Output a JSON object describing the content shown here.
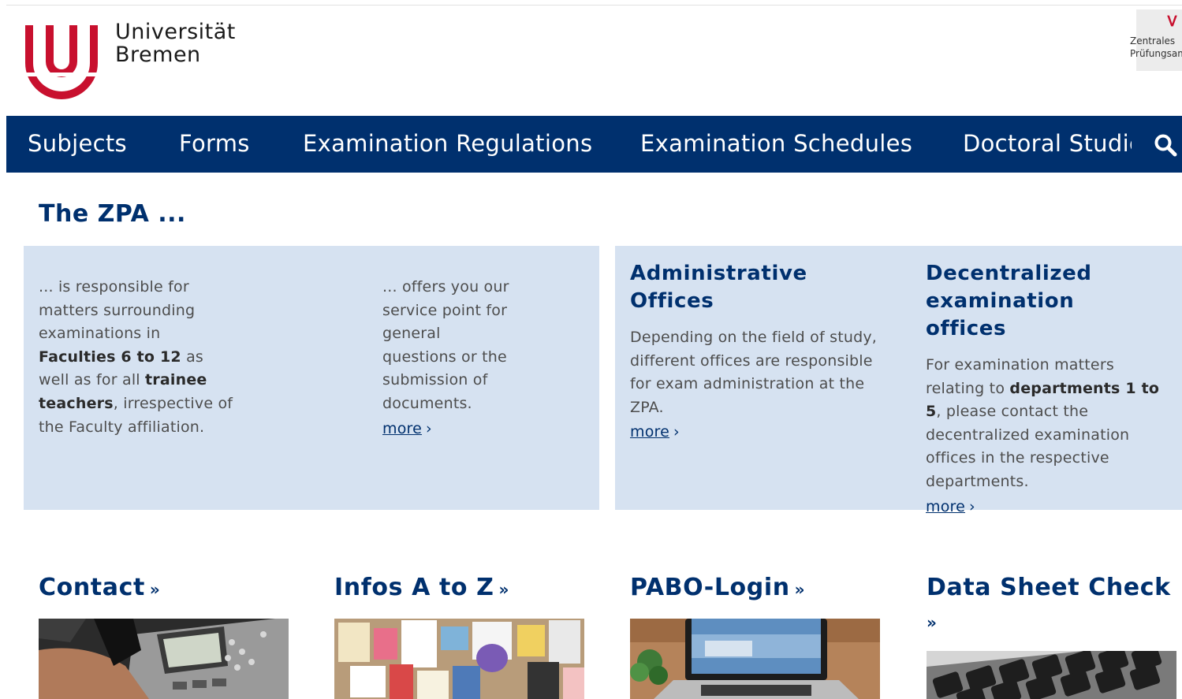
{
  "header": {
    "university_line1": "Universität",
    "university_line2": "Bremen",
    "zpa_logo_line1": "Zentrales",
    "zpa_logo_line2": "Prüfungsamt",
    "brand_red": "#c8102e",
    "brand_blue": "#00306e"
  },
  "nav": {
    "items": [
      {
        "label": "Subjects"
      },
      {
        "label": "Forms"
      },
      {
        "label": "Examination Regulations"
      },
      {
        "label": "Examination Schedules"
      },
      {
        "label": "Doctoral Studies"
      }
    ],
    "search_icon": "search-icon"
  },
  "intro": {
    "title": "The ZPA ...",
    "col1": {
      "t1": "... is responsible for matters surrounding examinations in ",
      "b1": "Faculties 6 to 12",
      "t2": " as well as for all ",
      "b2": "trainee teachers",
      "t3": ", irrespective of the Faculty affiliation."
    },
    "col2": {
      "text": "... offers you our service point for general questions or the submission of documents.",
      "more": "more"
    }
  },
  "admin": {
    "title": "Administrative Offices",
    "text": "Depending on the field of study, different offices are responsible for exam administration at the ZPA.",
    "more": "more"
  },
  "decentral": {
    "title": "Decentralized examination offices",
    "t1": "For examination matters relating to ",
    "b1": "departments 1 to 5",
    "t2": ", please contact the decentralized examination offices in the respective departments.",
    "more": "more"
  },
  "tiles": [
    {
      "title": "Contact",
      "suffix": "»"
    },
    {
      "title": "Infos A to Z",
      "suffix": "»"
    },
    {
      "title": "PABO-Login",
      "suffix": "»"
    },
    {
      "title": "Data Sheet Check",
      "suffix": "»"
    }
  ]
}
